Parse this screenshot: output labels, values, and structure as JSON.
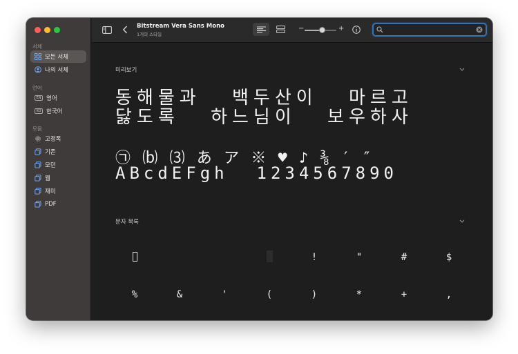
{
  "window": {
    "title": "Bitstream Vera Sans Mono",
    "subtitle": "1개의 스타일"
  },
  "sidebar": {
    "sections": [
      {
        "label": "서체",
        "items": [
          {
            "label": "모든 서체",
            "icon": "grid-icon",
            "selected": true
          },
          {
            "label": "나의 서체",
            "icon": "person-icon",
            "selected": false
          }
        ]
      },
      {
        "label": "언어",
        "items": [
          {
            "label": "영어",
            "icon": "en-badge-icon",
            "badge": "EN"
          },
          {
            "label": "한국어",
            "icon": "ko-badge-icon",
            "badge": "KO"
          }
        ]
      },
      {
        "label": "모음",
        "items": [
          {
            "label": "고정폭",
            "icon": "gear-icon"
          },
          {
            "label": "기존",
            "icon": "collection-icon"
          },
          {
            "label": "모던",
            "icon": "collection-icon"
          },
          {
            "label": "웹",
            "icon": "collection-icon"
          },
          {
            "label": "재미",
            "icon": "collection-icon"
          },
          {
            "label": "PDF",
            "icon": "collection-icon"
          }
        ]
      }
    ]
  },
  "toolbar": {
    "zoom_minus": "−",
    "zoom_plus": "+",
    "zoom_level": 0.55,
    "search": {
      "value": "",
      "placeholder": ""
    }
  },
  "preview": {
    "section_title": "미리보기",
    "lines": [
      "동해물과  백두산이  마르고",
      "닳도록  하느님이  보우하사",
      "㉠ ⒝ ⑶ あ ア ※ ♥ ♪ ⅜ ′ ″",
      "ABcdEFgh  1234567890"
    ]
  },
  "character_list": {
    "section_title": "문자 목록",
    "rows": [
      [
        "□",
        "",
        "",
        "▮",
        "!",
        "\"",
        "#",
        "$"
      ],
      [
        "%",
        "&",
        "'",
        "(",
        ")",
        "*",
        "+",
        ","
      ]
    ]
  },
  "colors": {
    "accent": "#3d6fa8",
    "sidebar_bg": "#3f3b3a",
    "content_bg": "#1e1e1e"
  }
}
